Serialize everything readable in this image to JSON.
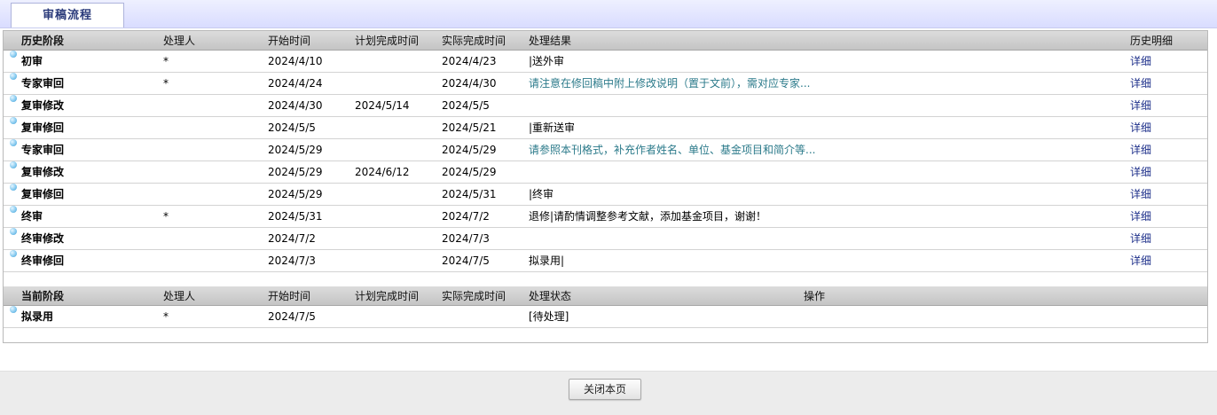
{
  "tab": {
    "label": "审稿流程"
  },
  "history": {
    "headers": [
      "历史阶段",
      "处理人",
      "开始时间",
      "计划完成时间",
      "实际完成时间",
      "处理结果",
      "历史明细"
    ],
    "rows": [
      {
        "stage": "初审",
        "handler": "*",
        "start": "2024/4/10",
        "planned": "",
        "actual": "2024/4/23",
        "result": "|送外审",
        "result_link": false,
        "detail": "详细"
      },
      {
        "stage": "专家审回",
        "handler": "*",
        "start": "2024/4/24",
        "planned": "",
        "actual": "2024/4/30",
        "result": "请注意在修回稿中附上修改说明（置于文前），需对应专家...",
        "result_link": true,
        "detail": "详细"
      },
      {
        "stage": "复审修改",
        "handler": "",
        "start": "2024/4/30",
        "planned": "2024/5/14",
        "actual": "2024/5/5",
        "result": "",
        "result_link": false,
        "detail": "详细"
      },
      {
        "stage": "复审修回",
        "handler": "",
        "start": "2024/5/5",
        "planned": "",
        "actual": "2024/5/21",
        "result": "|重新送审",
        "result_link": false,
        "detail": "详细"
      },
      {
        "stage": "专家审回",
        "handler": "",
        "start": "2024/5/29",
        "planned": "",
        "actual": "2024/5/29",
        "result": "请参照本刊格式，补充作者姓名、单位、基金项目和简介等...",
        "result_link": true,
        "detail": "详细"
      },
      {
        "stage": "复审修改",
        "handler": "",
        "start": "2024/5/29",
        "planned": "2024/6/12",
        "actual": "2024/5/29",
        "result": "",
        "result_link": false,
        "detail": "详细"
      },
      {
        "stage": "复审修回",
        "handler": "",
        "start": "2024/5/29",
        "planned": "",
        "actual": "2024/5/31",
        "result": "|终审",
        "result_link": false,
        "detail": "详细"
      },
      {
        "stage": "终审",
        "handler": "*",
        "start": "2024/5/31",
        "planned": "",
        "actual": "2024/7/2",
        "result": "退修|请酌情调整参考文献，添加基金项目，谢谢！",
        "result_link": false,
        "detail": "详细"
      },
      {
        "stage": "终审修改",
        "handler": "",
        "start": "2024/7/2",
        "planned": "",
        "actual": "2024/7/3",
        "result": "",
        "result_link": false,
        "detail": "详细"
      },
      {
        "stage": "终审修回",
        "handler": "",
        "start": "2024/7/3",
        "planned": "",
        "actual": "2024/7/5",
        "result": "拟录用|",
        "result_link": false,
        "detail": "详细"
      }
    ]
  },
  "current": {
    "headers": [
      "当前阶段",
      "处理人",
      "开始时间",
      "计划完成时间",
      "实际完成时间",
      "处理状态",
      "操作"
    ],
    "rows": [
      {
        "stage": "拟录用",
        "handler": "*",
        "start": "2024/7/5",
        "planned": "",
        "actual": "",
        "status": "[待处理]"
      }
    ]
  },
  "footer": {
    "close_label": "关闭本页"
  }
}
